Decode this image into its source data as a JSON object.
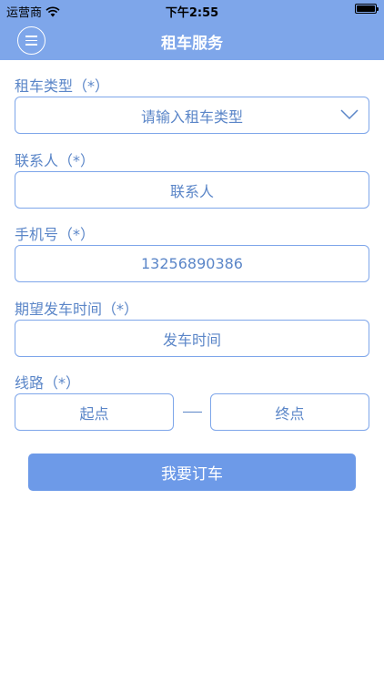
{
  "status_bar": {
    "carrier": "运营商",
    "time": "下午2:55"
  },
  "navbar": {
    "title": "租车服务",
    "menu_icon": "menu-icon"
  },
  "form": {
    "car_type": {
      "label": "租车类型（*）",
      "placeholder": "请输入租车类型"
    },
    "contact": {
      "label": "联系人（*）",
      "placeholder": "联系人"
    },
    "phone": {
      "label": "手机号（*）",
      "value": "13256890386"
    },
    "departure_time": {
      "label": "期望发车时间（*）",
      "placeholder": "发车时间"
    },
    "route": {
      "label": "线路（*）",
      "start_placeholder": "起点",
      "end_placeholder": "终点"
    }
  },
  "submit_button": {
    "label": "我要订车"
  },
  "colors": {
    "header": "#7ea6ea",
    "accent": "#5b86c8",
    "button": "#6d9ae8"
  }
}
